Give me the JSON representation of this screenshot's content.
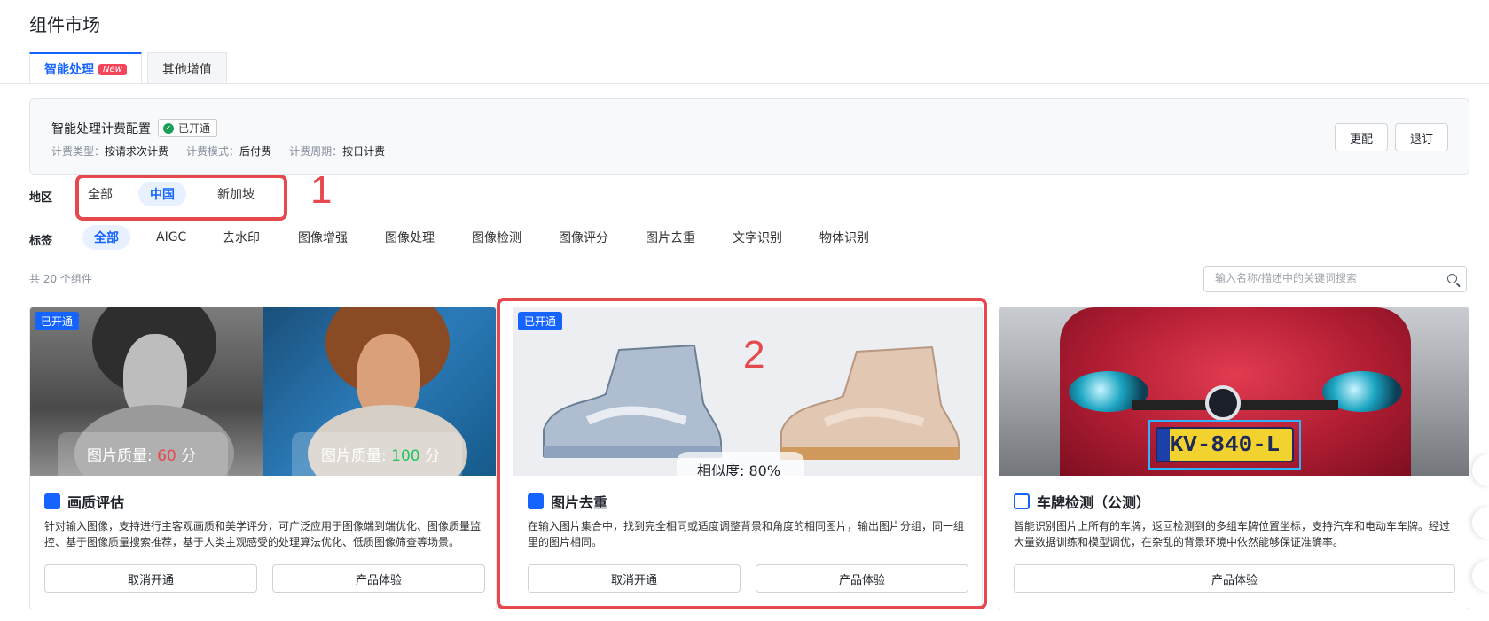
{
  "page": {
    "title": "组件市场"
  },
  "tabs": [
    {
      "label": "智能处理",
      "badge": "New",
      "active": true
    },
    {
      "label": "其他增值",
      "active": false
    }
  ],
  "billing": {
    "title": "智能处理计费配置",
    "status": "已开通",
    "meta": [
      {
        "key": "计费类型：",
        "value": "按请求次计费"
      },
      {
        "key": "计费模式：",
        "value": "后付费"
      },
      {
        "key": "计费周期：",
        "value": "按日计费"
      }
    ],
    "change_label": "更配",
    "cancel_label": "退订"
  },
  "region": {
    "label": "地区",
    "options": [
      "全部",
      "中国",
      "新加坡"
    ],
    "selected": "中国"
  },
  "tags": {
    "label": "标签",
    "options": [
      "全部",
      "AIGC",
      "去水印",
      "图像增强",
      "图像处理",
      "图像检测",
      "图像评分",
      "图片去重",
      "文字识别",
      "物体识别"
    ],
    "selected": "全部"
  },
  "annotations": {
    "first": "1",
    "second": "2"
  },
  "list": {
    "count_text": "共 20 个组件",
    "search_placeholder": "输入名称/描述中的关键词搜索"
  },
  "cards": [
    {
      "badge": "已开通",
      "title": "画质评估",
      "desc": "针对输入图像，支持进行主客观画质和美学评分，可广泛应用于图像端到端优化、图像质量监控、基于图像质量搜索推荐，基于人类主观感受的处理算法优化、低质图像筛查等场景。",
      "quality_prefix": "图片质量: ",
      "quality_left": "60",
      "quality_right": "100",
      "quality_suffix": " 分",
      "buttons": [
        "取消开通",
        "产品体验"
      ]
    },
    {
      "badge": "已开通",
      "title": "图片去重",
      "desc": "在输入图片集合中，找到完全相同或适度调整背景和角度的相同图片，输出图片分组，同一组里的图片相同。",
      "similarity": "相似度: 80%",
      "buttons": [
        "取消开通",
        "产品体验"
      ]
    },
    {
      "title": "车牌检测（公测）",
      "desc": "智能识别图片上所有的车牌，返回检测到的多组车牌位置坐标，支持汽车和电动车车牌。经过大量数据训练和模型调优，在杂乱的背景环境中依然能够保证准确率。",
      "plate": "KV-840-L",
      "buttons": [
        "产品体验"
      ]
    }
  ],
  "colors": {
    "accent": "#1664ff",
    "annotation": "#e5484d",
    "badge_new": "#f5455b"
  }
}
